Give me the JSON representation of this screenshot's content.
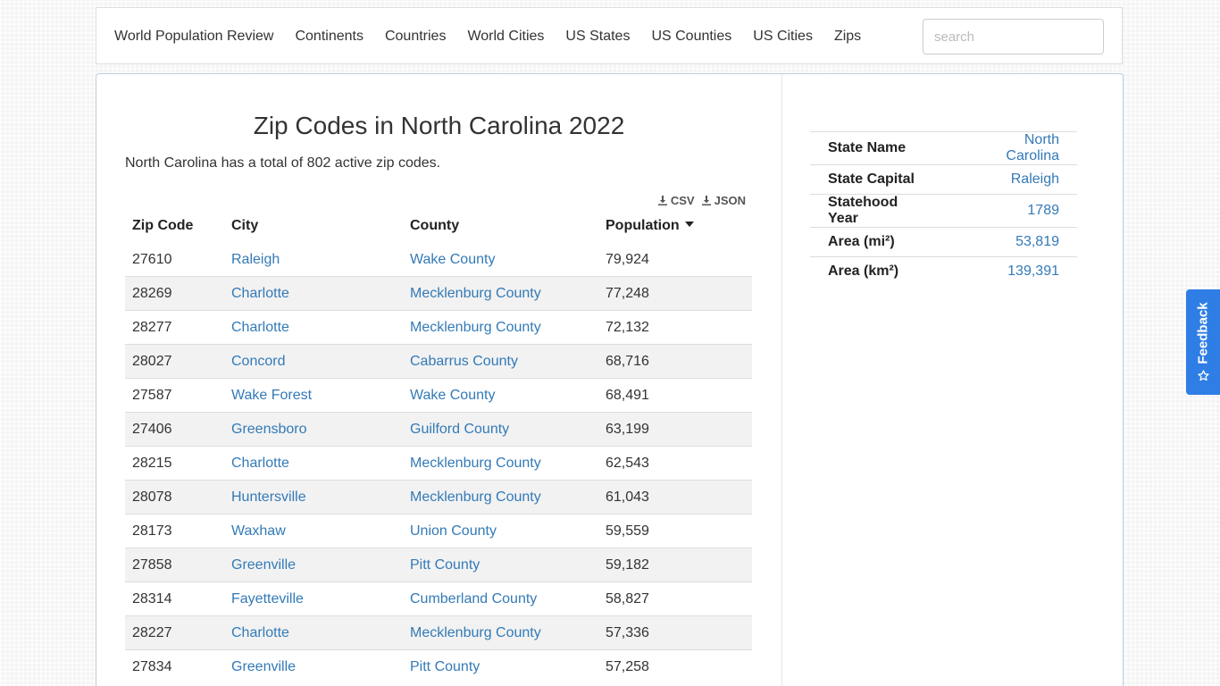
{
  "nav": {
    "items": [
      {
        "label": "World Population Review"
      },
      {
        "label": "Continents"
      },
      {
        "label": "Countries"
      },
      {
        "label": "World Cities"
      },
      {
        "label": "US States"
      },
      {
        "label": "US Counties"
      },
      {
        "label": "US Cities"
      },
      {
        "label": "Zips"
      }
    ],
    "search_placeholder": "search"
  },
  "main": {
    "title": "Zip Codes in North Carolina 2022",
    "summary": "North Carolina has a total of 802 active zip codes.",
    "downloads": {
      "csv": "CSV",
      "json": "JSON",
      "icon": "download-icon"
    },
    "table": {
      "headers": {
        "zip": "Zip Code",
        "city": "City",
        "county": "County",
        "population": "Population"
      },
      "sort_icon": "caret-down-icon",
      "rows": [
        {
          "zip": "27610",
          "city": "Raleigh",
          "county": "Wake County",
          "population": "79,924"
        },
        {
          "zip": "28269",
          "city": "Charlotte",
          "county": "Mecklenburg County",
          "population": "77,248"
        },
        {
          "zip": "28277",
          "city": "Charlotte",
          "county": "Mecklenburg County",
          "population": "72,132"
        },
        {
          "zip": "28027",
          "city": "Concord",
          "county": "Cabarrus County",
          "population": "68,716"
        },
        {
          "zip": "27587",
          "city": "Wake Forest",
          "county": "Wake County",
          "population": "68,491"
        },
        {
          "zip": "27406",
          "city": "Greensboro",
          "county": "Guilford County",
          "population": "63,199"
        },
        {
          "zip": "28215",
          "city": "Charlotte",
          "county": "Mecklenburg County",
          "population": "62,543"
        },
        {
          "zip": "28078",
          "city": "Huntersville",
          "county": "Mecklenburg County",
          "population": "61,043"
        },
        {
          "zip": "28173",
          "city": "Waxhaw",
          "county": "Union County",
          "population": "59,559"
        },
        {
          "zip": "27858",
          "city": "Greenville",
          "county": "Pitt County",
          "population": "59,182"
        },
        {
          "zip": "28314",
          "city": "Fayetteville",
          "county": "Cumberland County",
          "population": "58,827"
        },
        {
          "zip": "28227",
          "city": "Charlotte",
          "county": "Mecklenburg County",
          "population": "57,336"
        },
        {
          "zip": "27834",
          "city": "Greenville",
          "county": "Pitt County",
          "population": "57,258"
        }
      ]
    }
  },
  "sidebar": {
    "info": [
      {
        "key": "State Name",
        "value": "North Carolina"
      },
      {
        "key": "State Capital",
        "value": "Raleigh"
      },
      {
        "key": "Statehood Year",
        "value": "1789"
      },
      {
        "key": "Area (mi²)",
        "value": "53,819"
      },
      {
        "key": "Area (km²)",
        "value": "139,391"
      }
    ]
  },
  "feedback": {
    "label": "Feedback",
    "icon": "star-icon"
  },
  "colors": {
    "link": "#337ab7",
    "feedback_bg": "#2f7ee6",
    "stripe": "#f2f2f2"
  }
}
